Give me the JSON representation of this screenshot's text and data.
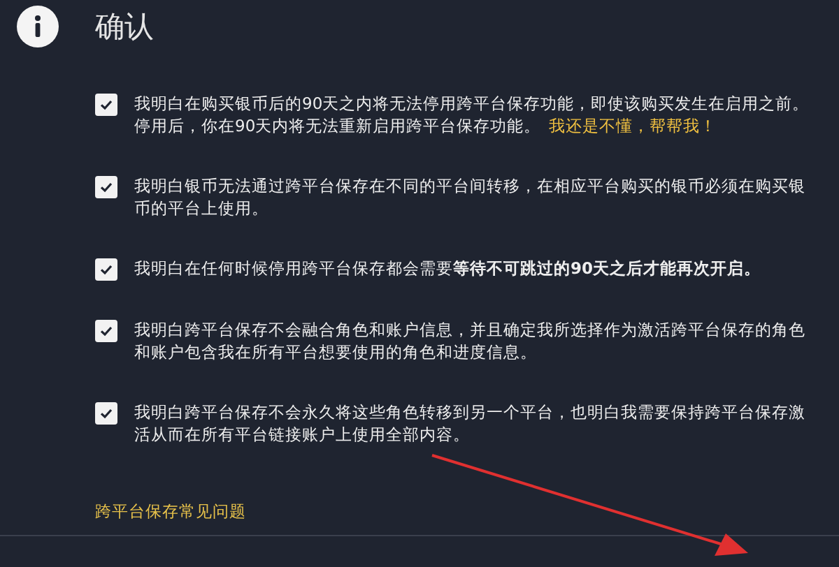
{
  "dialog": {
    "title": "确认",
    "items": [
      {
        "checked": true,
        "text": "我明白在购买银币后的90天之内将无法停用跨平台保存功能，即使该购买发生在启用之前。停用后，你在90天内将无法重新启用跨平台保存功能。",
        "link": "我还是不懂，帮帮我！"
      },
      {
        "checked": true,
        "text": "我明白银币无法通过跨平台保存在不同的平台间转移，在相应平台购买的银币必须在购买银币的平台上使用。"
      },
      {
        "checked": true,
        "text": "我明白在任何时候停用跨平台保存都会需要**等待不可跳过的90天之后才能再次开启。**"
      },
      {
        "checked": true,
        "text": "我明白跨平台保存不会融合角色和账户信息，并且确定我所选择作为激活跨平台保存的角色和账户包含我在所有平台想要使用的角色和进度信息。"
      },
      {
        "checked": true,
        "text": "我明白跨平台保存不会永久将这些角色转移到另一个平台，也明白我需要保持跨平台保存激活从而在所有平台链接账户上使用全部内容。"
      }
    ],
    "faq_link": "跨平台保存常见问题"
  }
}
